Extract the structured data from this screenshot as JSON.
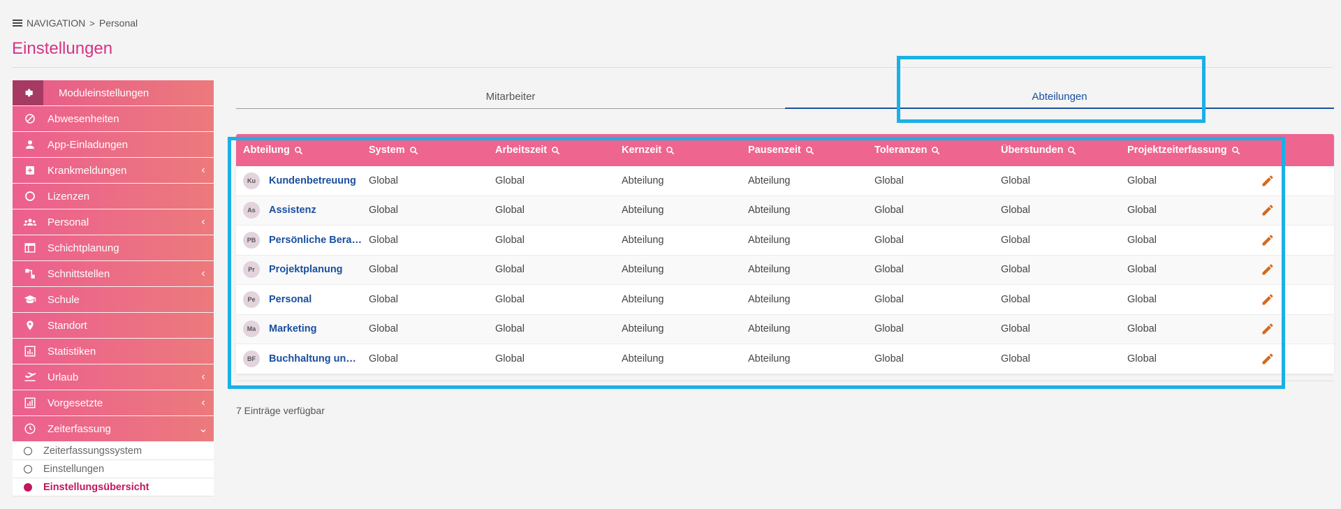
{
  "breadcrumb": {
    "root": "NAVIGATION",
    "separator": ">",
    "current": "Personal"
  },
  "page": {
    "title": "Einstellungen"
  },
  "sidebar": {
    "header": {
      "label": "Moduleinstellungen",
      "icon": "gear-icon"
    },
    "items": [
      {
        "label": "Abwesenheiten",
        "icon": "ban-icon",
        "expandable": false
      },
      {
        "label": "App-Einladungen",
        "icon": "person-icon",
        "expandable": false
      },
      {
        "label": "Krankmeldungen",
        "icon": "medical-icon",
        "expandable": true
      },
      {
        "label": "Lizenzen",
        "icon": "circle-icon",
        "expandable": false
      },
      {
        "label": "Personal",
        "icon": "group-icon",
        "expandable": true
      },
      {
        "label": "Schichtplanung",
        "icon": "calendar-icon",
        "expandable": false
      },
      {
        "label": "Schnittstellen",
        "icon": "interface-icon",
        "expandable": true
      },
      {
        "label": "Schule",
        "icon": "school-icon",
        "expandable": false
      },
      {
        "label": "Standort",
        "icon": "location-icon",
        "expandable": false
      },
      {
        "label": "Statistiken",
        "icon": "stats-icon",
        "expandable": false
      },
      {
        "label": "Urlaub",
        "icon": "plane-icon",
        "expandable": true
      },
      {
        "label": "Vorgesetzte",
        "icon": "chart-icon",
        "expandable": true
      },
      {
        "label": "Zeiterfassung",
        "icon": "clock-icon",
        "expandable": true,
        "expanded": true
      }
    ],
    "subitems": [
      {
        "label": "Zeiterfassungssystem",
        "active": false
      },
      {
        "label": "Einstellungen",
        "active": false
      },
      {
        "label": "Einstellungsübersicht",
        "active": true
      }
    ]
  },
  "tabs": [
    {
      "label": "Mitarbeiter",
      "active": false
    },
    {
      "label": "Abteilungen",
      "active": true
    }
  ],
  "table": {
    "columns": [
      "Abteilung",
      "System",
      "Arbeitszeit",
      "Kernzeit",
      "Pausenzeit",
      "Toleranzen",
      "Überstunden",
      "Projektzeiterfassung"
    ],
    "rows": [
      {
        "initials": "Ku",
        "name": "Kundenbetreuung",
        "system": "Global",
        "arbeitszeit": "Global",
        "kernzeit": "Abteilung",
        "pausenzeit": "Abteilung",
        "toleranzen": "Global",
        "ueberstunden": "Global",
        "projektzeiterfassung": "Global"
      },
      {
        "initials": "As",
        "name": "Assistenz",
        "system": "Global",
        "arbeitszeit": "Global",
        "kernzeit": "Abteilung",
        "pausenzeit": "Abteilung",
        "toleranzen": "Global",
        "ueberstunden": "Global",
        "projektzeiterfassung": "Global"
      },
      {
        "initials": "PB",
        "name": "Persönliche Berat…",
        "system": "Global",
        "arbeitszeit": "Global",
        "kernzeit": "Abteilung",
        "pausenzeit": "Abteilung",
        "toleranzen": "Global",
        "ueberstunden": "Global",
        "projektzeiterfassung": "Global"
      },
      {
        "initials": "Pr",
        "name": "Projektplanung",
        "system": "Global",
        "arbeitszeit": "Global",
        "kernzeit": "Abteilung",
        "pausenzeit": "Abteilung",
        "toleranzen": "Global",
        "ueberstunden": "Global",
        "projektzeiterfassung": "Global"
      },
      {
        "initials": "Pe",
        "name": "Personal",
        "system": "Global",
        "arbeitszeit": "Global",
        "kernzeit": "Abteilung",
        "pausenzeit": "Abteilung",
        "toleranzen": "Global",
        "ueberstunden": "Global",
        "projektzeiterfassung": "Global"
      },
      {
        "initials": "Ma",
        "name": "Marketing",
        "system": "Global",
        "arbeitszeit": "Global",
        "kernzeit": "Abteilung",
        "pausenzeit": "Abteilung",
        "toleranzen": "Global",
        "ueberstunden": "Global",
        "projektzeiterfassung": "Global"
      },
      {
        "initials": "BF",
        "name": "Buchhaltung und …",
        "system": "Global",
        "arbeitszeit": "Global",
        "kernzeit": "Abteilung",
        "pausenzeit": "Abteilung",
        "toleranzen": "Global",
        "ueberstunden": "Global",
        "projektzeiterfassung": "Global"
      }
    ]
  },
  "footer": {
    "entries_text": "7 Einträge verfügbar"
  },
  "colors": {
    "accent": "#ee6590",
    "title": "#d63384",
    "link": "#1a4fa0",
    "highlight": "#1ab0e8",
    "edit": "#d2691e"
  }
}
